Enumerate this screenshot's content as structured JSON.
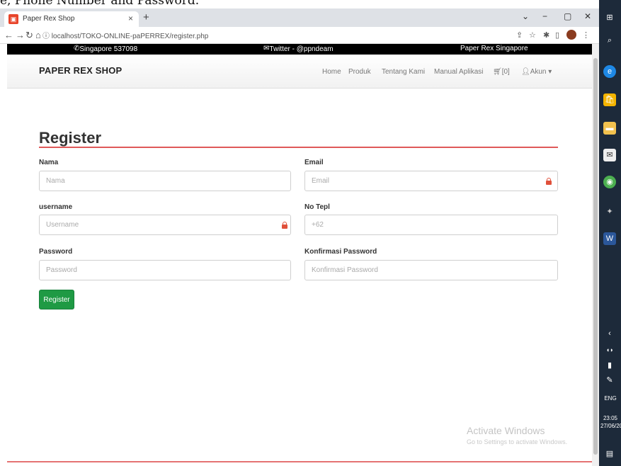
{
  "caption": "e, Phone Number and Password.",
  "browser": {
    "tab_title": "Paper Rex Shop",
    "tab_close": "×",
    "new_tab": "+",
    "url": "localhost/TOKO-ONLINE-paPERREX/register.php"
  },
  "infobar": {
    "phone": "Singapore 537098",
    "twitter": "Twitter - @ppndeam",
    "company": "Paper Rex Singapore"
  },
  "navbar": {
    "brand": "PAPER REX SHOP",
    "items": [
      "Home",
      "Produk",
      "Tentang Kami",
      "Manual Aplikasi"
    ],
    "cart": "[0]",
    "account": "Akun"
  },
  "form": {
    "title": "Register",
    "nama_label": "Nama",
    "nama_placeholder": "Nama",
    "email_label": "Email",
    "email_placeholder": "Email",
    "username_label": "username",
    "username_placeholder": "Username",
    "phone_label": "No Tepl",
    "phone_value": "+62",
    "password_label": "Password",
    "password_placeholder": "Password",
    "confirm_label": "Konfirmasi Password",
    "confirm_placeholder": "Konfirmasi Password",
    "submit_label": "Register"
  },
  "watermark": {
    "title": "Activate Windows",
    "subtitle": "Go to Settings to activate Windows."
  },
  "taskbar": {
    "language": "ENG",
    "time": "23:05",
    "date": "27/06/20"
  },
  "colors": {
    "accent_rule": "#e05959",
    "button": "#1f9a44",
    "lock_icon": "#e0503a",
    "infobar": "#000000"
  }
}
